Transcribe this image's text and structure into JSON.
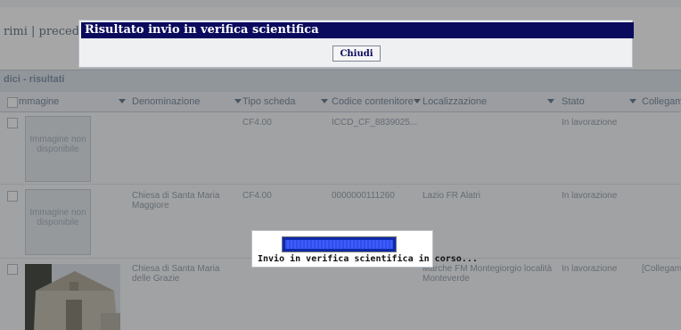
{
  "pager": {
    "text": "rimi | precede"
  },
  "section": {
    "title": "dici - risultati"
  },
  "columns": [
    {
      "label": "Immagine"
    },
    {
      "label": "Denominazione"
    },
    {
      "label": "Tipo scheda"
    },
    {
      "label": "Codice contenitore"
    },
    {
      "label": "Localizzazione"
    },
    {
      "label": "Stato"
    },
    {
      "label": "Collegame"
    }
  ],
  "rows": [
    {
      "placeholder": "Immagine non disponibile",
      "denominazione": "",
      "tipo_scheda": "CF4.00",
      "codice": "ICCD_CF_8839025...",
      "localizzazione": "",
      "stato": "In lavorazione",
      "collegamento": ""
    },
    {
      "placeholder": "Immagine non disponibile",
      "denominazione": "Chiesa di Santa Maria Maggiore",
      "tipo_scheda": "CF4.00",
      "codice": "0000000111260",
      "localizzazione": "Lazio FR Alatri",
      "stato": "In lavorazione",
      "collegamento": ""
    },
    {
      "placeholder": "",
      "denominazione": "Chiesa di Santa Maria delle Grazie",
      "tipo_scheda": "",
      "codice": "",
      "localizzazione": "Marche FM Montegiorgio località Monteverde",
      "stato": "In lavorazione",
      "collegamento": "[Collegam"
    }
  ],
  "dialog": {
    "title": "Risultato invio in verifica scientifica",
    "close_label": "Chiudi"
  },
  "progress": {
    "text": "Invio in verifica scientifica in corso..."
  },
  "colors": {
    "dialog_title_bg": "#0b0b5e",
    "progress_fill": "#2f4fe6"
  }
}
